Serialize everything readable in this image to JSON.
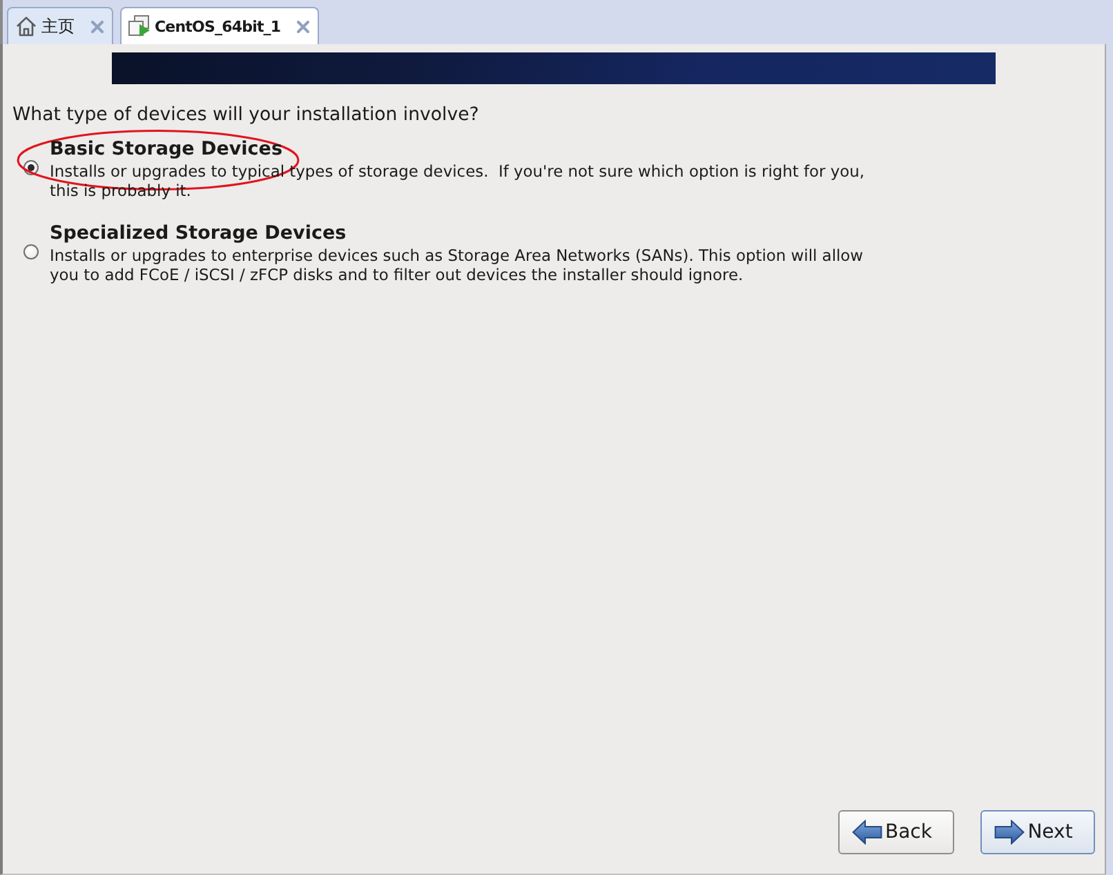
{
  "tabs": [
    {
      "label": "主页",
      "kind": "home",
      "selected": false
    },
    {
      "label": "CentOS_64bit_1",
      "kind": "vm",
      "selected": true
    }
  ],
  "installer": {
    "question": "What type of devices will your installation involve?",
    "options": [
      {
        "title": "Basic Storage Devices",
        "description": "Installs or upgrades to typical types of storage devices.  If you're not sure which option is right for you, this is probably it.",
        "selected": true,
        "circled": true
      },
      {
        "title": "Specialized Storage Devices",
        "description": "Installs or upgrades to enterprise devices such as Storage Area Networks (SANs). This option will allow you to add FCoE / iSCSI / zFCP disks and to filter out devices the installer should ignore.",
        "selected": false,
        "circled": false
      }
    ],
    "buttons": [
      {
        "label": "Back",
        "kind": "back",
        "default": false
      },
      {
        "label": "Next",
        "kind": "next",
        "default": true
      }
    ]
  }
}
